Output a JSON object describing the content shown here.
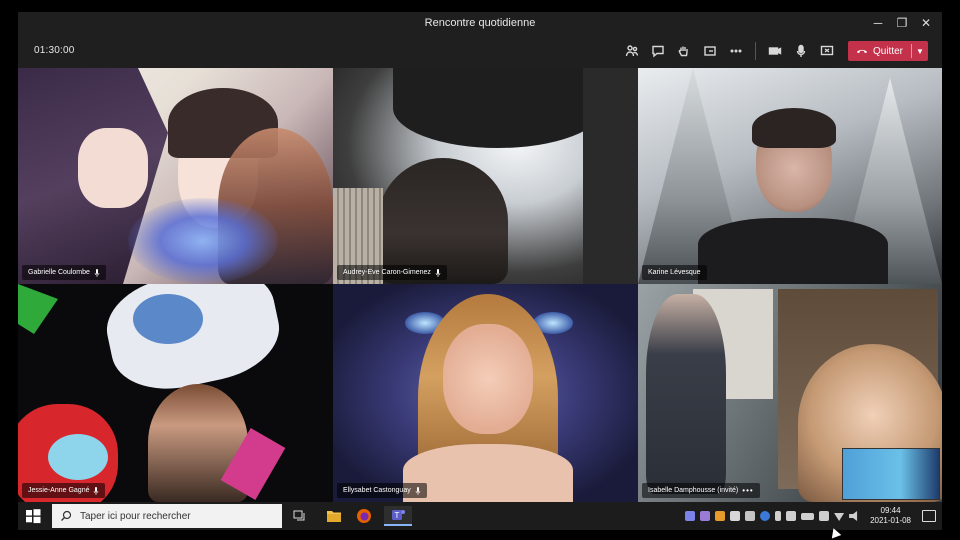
{
  "window": {
    "title": "Rencontre quotidienne",
    "controls": {
      "minimize": "─",
      "restore": "❐",
      "close": "✕"
    }
  },
  "toolbar": {
    "timer": "01:30:00",
    "leave_label": "Quitter",
    "accent": "#c4314b"
  },
  "participants": [
    {
      "name": "Gabrielle Coulombe",
      "more": ""
    },
    {
      "name": "Audrey-Eve Caron-Gimenez",
      "more": ""
    },
    {
      "name": "Karine Lévesque",
      "more": ""
    },
    {
      "name": "Jessie-Anne Gagné",
      "more": ""
    },
    {
      "name": "Ellysabet Castonguay",
      "more": ""
    },
    {
      "name": "Isabelle Damphousse (invité)",
      "more": "•••"
    }
  ],
  "taskbar": {
    "search_placeholder": "Taper ici pour rechercher",
    "time": "09:44",
    "date": "2021-01-08"
  }
}
